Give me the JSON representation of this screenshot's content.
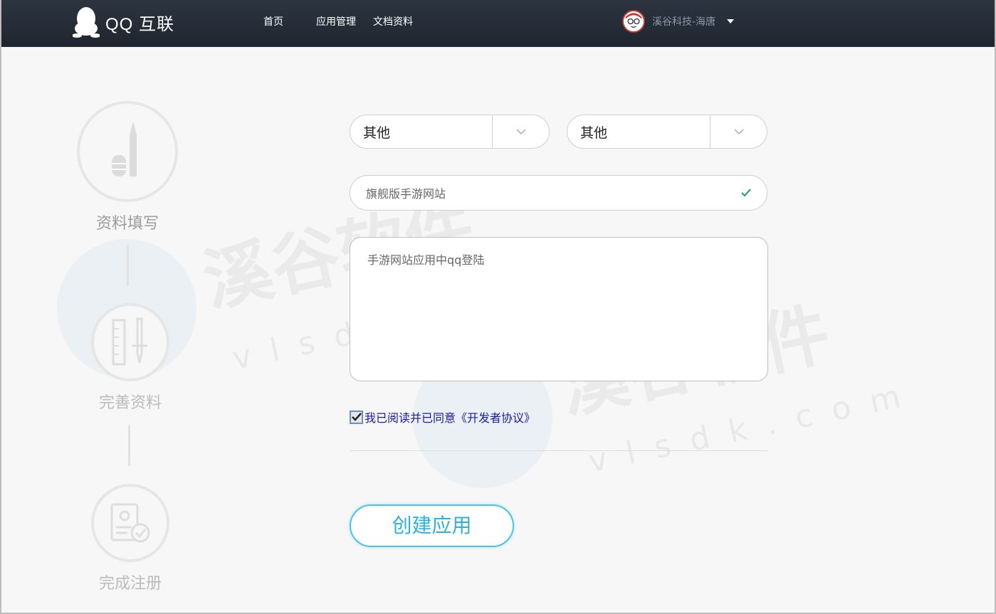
{
  "header": {
    "logo_text": "QQ 互联",
    "nav": [
      "首页",
      "应用管理",
      "文档资料"
    ],
    "user_name": "溪谷科技-海唐"
  },
  "steps": [
    {
      "label": "资料填写",
      "icon": "pen-icon"
    },
    {
      "label": "完善资料",
      "icon": "ruler-pen-icon"
    },
    {
      "label": "完成注册",
      "icon": "id-card-check-icon"
    }
  ],
  "form": {
    "select_1": "其他",
    "select_2": "其他",
    "app_name": "旗舰版手游网站",
    "description": "手游网站应用中qq登陆",
    "agree_text": "我已阅读并已同意《开发者协议》",
    "agree_checked": true,
    "submit_label": "创建应用"
  },
  "watermark": {
    "text": "溪谷软件",
    "url": "vlsdk.com"
  },
  "colors": {
    "topbar": "#232a33",
    "accent": "#49c4ea",
    "valid_check": "#19a15f",
    "link": "#1a1aa8"
  }
}
